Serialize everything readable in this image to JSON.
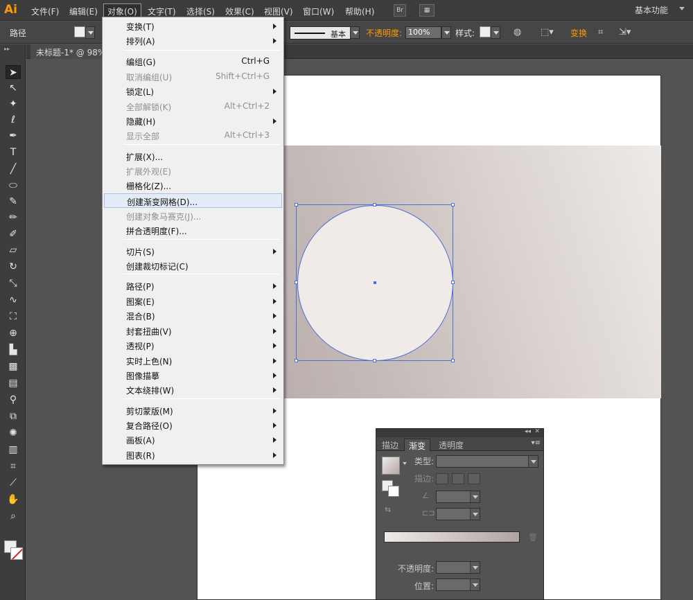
{
  "app": {
    "logo": "Ai"
  },
  "menubar": {
    "items": [
      "文件(F)",
      "编辑(E)",
      "对象(O)",
      "文字(T)",
      "选择(S)",
      "效果(C)",
      "视图(V)",
      "窗口(W)",
      "帮助(H)"
    ],
    "br_icon": "Br",
    "workspace": "基本功能"
  },
  "controlbar": {
    "label": "路径",
    "stroke_style": "基本",
    "opacity_label": "不透明度:",
    "opacity_value": "100%",
    "style_label": "样式:",
    "transform_label": "变换"
  },
  "document": {
    "tab_title": "未标题-1* @ 98%"
  },
  "object_menu": {
    "items": [
      {
        "label": "变换(T)",
        "shortcut": "",
        "submenu": true,
        "disabled": false
      },
      {
        "label": "排列(A)",
        "shortcut": "",
        "submenu": true,
        "disabled": false
      },
      {
        "label": "编组(G)",
        "shortcut": "Ctrl+G",
        "submenu": false,
        "disabled": false
      },
      {
        "label": "取消编组(U)",
        "shortcut": "Shift+Ctrl+G",
        "submenu": false,
        "disabled": true
      },
      {
        "label": "锁定(L)",
        "shortcut": "",
        "submenu": true,
        "disabled": false
      },
      {
        "label": "全部解锁(K)",
        "shortcut": "Alt+Ctrl+2",
        "submenu": false,
        "disabled": true
      },
      {
        "label": "隐藏(H)",
        "shortcut": "",
        "submenu": true,
        "disabled": false
      },
      {
        "label": "显示全部",
        "shortcut": "Alt+Ctrl+3",
        "submenu": false,
        "disabled": true
      },
      {
        "label": "扩展(X)...",
        "shortcut": "",
        "submenu": false,
        "disabled": false
      },
      {
        "label": "扩展外观(E)",
        "shortcut": "",
        "submenu": false,
        "disabled": true
      },
      {
        "label": "栅格化(Z)...",
        "shortcut": "",
        "submenu": false,
        "disabled": false
      },
      {
        "label": "创建渐变网格(D)...",
        "shortcut": "",
        "submenu": false,
        "disabled": false,
        "highlighted": true
      },
      {
        "label": "创建对象马赛克(J)...",
        "shortcut": "",
        "submenu": false,
        "disabled": true
      },
      {
        "label": "拼合透明度(F)...",
        "shortcut": "",
        "submenu": false,
        "disabled": false
      },
      {
        "label": "切片(S)",
        "shortcut": "",
        "submenu": true,
        "disabled": false
      },
      {
        "label": "创建裁切标记(C)",
        "shortcut": "",
        "submenu": false,
        "disabled": false
      },
      {
        "label": "路径(P)",
        "shortcut": "",
        "submenu": true,
        "disabled": false
      },
      {
        "label": "图案(E)",
        "shortcut": "",
        "submenu": true,
        "disabled": false
      },
      {
        "label": "混合(B)",
        "shortcut": "",
        "submenu": true,
        "disabled": false
      },
      {
        "label": "封套扭曲(V)",
        "shortcut": "",
        "submenu": true,
        "disabled": false
      },
      {
        "label": "透视(P)",
        "shortcut": "",
        "submenu": true,
        "disabled": false
      },
      {
        "label": "实时上色(N)",
        "shortcut": "",
        "submenu": true,
        "disabled": false
      },
      {
        "label": "图像描摹",
        "shortcut": "",
        "submenu": true,
        "disabled": false
      },
      {
        "label": "文本绕排(W)",
        "shortcut": "",
        "submenu": true,
        "disabled": false
      },
      {
        "label": "剪切蒙版(M)",
        "shortcut": "",
        "submenu": true,
        "disabled": false
      },
      {
        "label": "复合路径(O)",
        "shortcut": "",
        "submenu": true,
        "disabled": false
      },
      {
        "label": "画板(A)",
        "shortcut": "",
        "submenu": true,
        "disabled": false
      },
      {
        "label": "图表(R)",
        "shortcut": "",
        "submenu": true,
        "disabled": false
      }
    ]
  },
  "gradient_panel": {
    "tabs": [
      "描边",
      "渐变",
      "透明度"
    ],
    "active_tab": "渐变",
    "type_label": "类型:",
    "stroke_label": "描边:",
    "opacity_label": "不透明度:",
    "position_label": "位置:"
  },
  "tools": [
    "selection-tool",
    "direct-selection-tool",
    "magic-wand-tool",
    "lasso-tool",
    "pen-tool",
    "type-tool",
    "line-tool",
    "ellipse-tool",
    "paintbrush-tool",
    "pencil-tool",
    "blob-brush-tool",
    "eraser-tool",
    "rotate-tool",
    "scale-tool",
    "warp-tool",
    "free-transform-tool",
    "shape-builder-tool",
    "perspective-grid-tool",
    "mesh-tool",
    "gradient-tool",
    "eyedropper-tool",
    "blend-tool",
    "symbol-sprayer-tool",
    "column-graph-tool",
    "artboard-tool",
    "slice-tool",
    "hand-tool",
    "zoom-tool"
  ],
  "colors": {
    "accent": "#ff9a00",
    "selection": "#4a6fd6",
    "circle_fill": "#f0ebe8",
    "gradient_start": "#b3a7a5",
    "gradient_end": "#eeebe8"
  }
}
